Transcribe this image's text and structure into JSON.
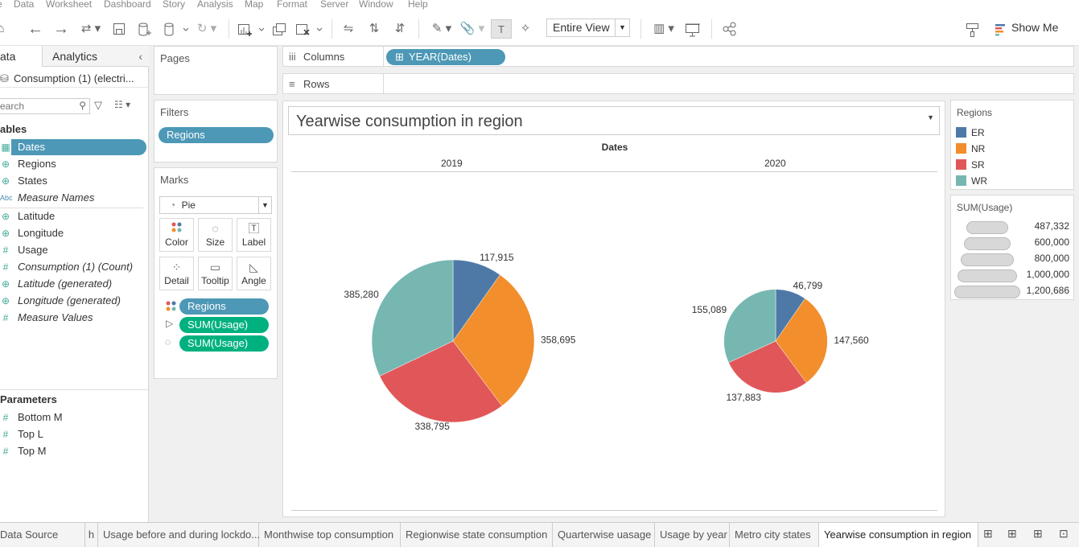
{
  "menu": [
    "e",
    "Data",
    "Worksheet",
    "Dashboard",
    "Story",
    "Analysis",
    "Map",
    "Format",
    "Server",
    "Window",
    "Help"
  ],
  "toolbar": {
    "view_select": "Entire View",
    "show_me": "Show Me"
  },
  "left": {
    "tab_data": "ata",
    "tab_analytics": "Analytics",
    "datasource": "Consumption (1) (electri...",
    "search_placeholder": "earch",
    "tables_header": "ables",
    "fields": [
      {
        "icon": "calendar",
        "name": "Dates",
        "italic": false,
        "selected": true
      },
      {
        "icon": "globe",
        "name": "Regions",
        "italic": false
      },
      {
        "icon": "globe",
        "name": "States",
        "italic": false
      },
      {
        "icon": "Abc",
        "name": "Measure Names",
        "italic": true
      },
      {
        "icon": "globe",
        "name": "Latitude",
        "italic": false
      },
      {
        "icon": "globe",
        "name": "Longitude",
        "italic": false
      },
      {
        "icon": "#",
        "name": "Usage",
        "italic": false
      },
      {
        "icon": "#",
        "name": "Consumption (1) (Count)",
        "italic": true
      },
      {
        "icon": "globe",
        "name": "Latitude (generated)",
        "italic": true
      },
      {
        "icon": "globe",
        "name": "Longitude (generated)",
        "italic": true
      },
      {
        "icon": "#",
        "name": "Measure Values",
        "italic": true
      }
    ],
    "parameters_header": "Parameters",
    "parameters": [
      "Bottom M",
      "Top L",
      "Top M"
    ]
  },
  "pages": {
    "title": "Pages"
  },
  "filters": {
    "title": "Filters",
    "pill": "Regions"
  },
  "marks": {
    "title": "Marks",
    "type": "Pie",
    "buttons": [
      "Color",
      "Size",
      "Label",
      "Detail",
      "Tooltip",
      "Angle"
    ],
    "pills": [
      "Regions",
      "SUM(Usage)",
      "SUM(Usage)"
    ]
  },
  "shelves": {
    "columns_label": "Columns",
    "columns_pill": "YEAR(Dates)",
    "rows_label": "Rows"
  },
  "viz": {
    "title": "Yearwise consumption in region",
    "header": "Dates",
    "years": [
      "2019",
      "2020"
    ]
  },
  "chart_data": {
    "type": "pie",
    "categories": [
      "ER",
      "NR",
      "SR",
      "WR"
    ],
    "colors": [
      "#4e79a7",
      "#f28e2b",
      "#e15759",
      "#76b7b2"
    ],
    "series": [
      {
        "name": "2019",
        "values": [
          117915,
          358695,
          338795,
          385280
        ]
      },
      {
        "name": "2020",
        "values": [
          46799,
          147560,
          137883,
          155089
        ]
      }
    ],
    "size_by": "SUM(Usage)"
  },
  "legend_regions": {
    "title": "Regions",
    "items": [
      "ER",
      "NR",
      "SR",
      "WR"
    ]
  },
  "legend_size": {
    "title": "SUM(Usage)",
    "items": [
      "487,332",
      "600,000",
      "800,000",
      "1,000,000",
      "1,200,686"
    ]
  },
  "sheet_tabs": [
    "Data Source",
    "h",
    "Usage before and during lockdo...",
    "Monthwise top consumption",
    "Regionwise state consumption",
    "Quarterwise uasage",
    "Usage by year",
    "Metro city states",
    "Yearwise consumption in region"
  ]
}
